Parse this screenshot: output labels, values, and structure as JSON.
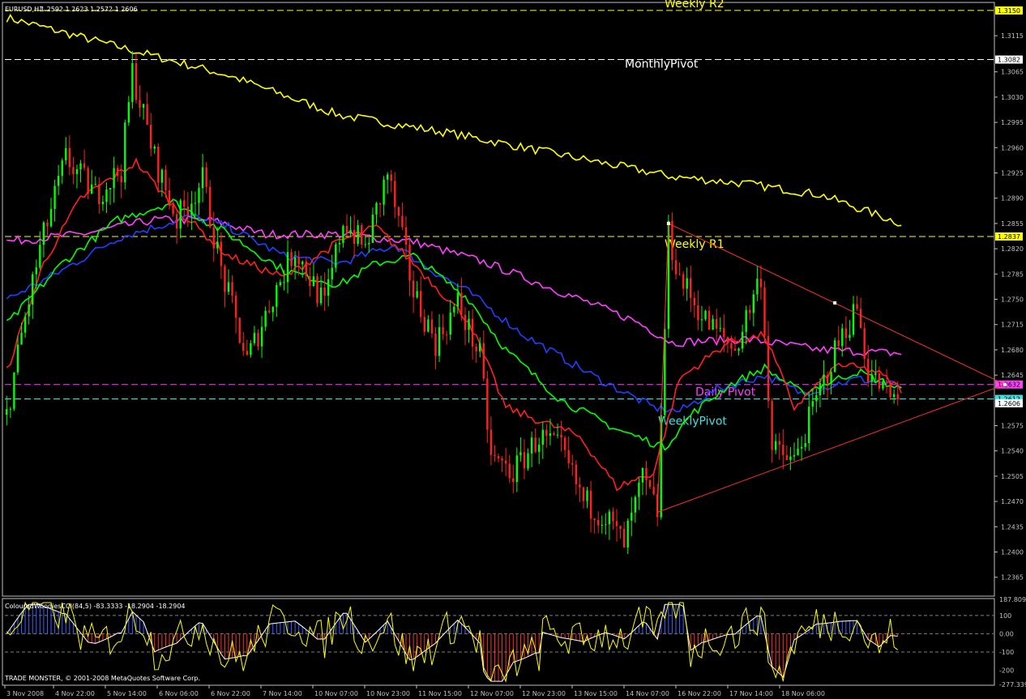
{
  "chart_header": {
    "symbol": "EURUSD,H1",
    "ohlc": "1.2592 1.2623 1.2572 1.2606"
  },
  "indicator_header": "ColouredWoodiesCCI(84,5) -83.3333 -18.2904 -18.2904",
  "copyright": "TRADE MONSTER, © 2001-2008 MetaQuotes Software Corp.",
  "colors": {
    "background": "#000000",
    "axis": "#c0c0c0",
    "bull": "#00ff00",
    "bear": "#ff2020",
    "yellow": "#ffff00",
    "magenta": "#ff40ff",
    "cyan": "#40e0e0",
    "blue": "#2040ff",
    "white": "#ffffff"
  },
  "chart_data": [
    {
      "type": "line",
      "title": "EURUSD,H1",
      "y_ticks": [
        "1.3115",
        "1.3065",
        "1.3030",
        "1.2995",
        "1.2960",
        "1.2925",
        "1.2890",
        "1.2855",
        "1.2820",
        "1.2785",
        "1.2750",
        "1.2715",
        "1.2680",
        "1.2645",
        "1.2575",
        "1.2540",
        "1.2505",
        "1.2470",
        "1.2435",
        "1.2400",
        "1.2365"
      ],
      "y_tick_values": [
        1.3115,
        1.3065,
        1.303,
        1.2995,
        1.296,
        1.2925,
        1.289,
        1.2855,
        1.282,
        1.2785,
        1.275,
        1.2715,
        1.268,
        1.2645,
        1.2575,
        1.254,
        1.2505,
        1.247,
        1.2435,
        1.24,
        1.2365
      ],
      "ylim": [
        1.234,
        1.316
      ],
      "x_labels": [
        "3 Nov 2008",
        "4 Nov 22:00",
        "5 Nov 14:00",
        "6 Nov 06:00",
        "6 Nov 22:00",
        "7 Nov 14:00",
        "10 Nov 07:00",
        "10 Nov 23:00",
        "11 Nov 15:00",
        "12 Nov 07:00",
        "12 Nov 23:00",
        "13 Nov 15:00",
        "14 Nov 07:00",
        "16 Nov 22:00",
        "17 Nov 14:00",
        "18 Nov 06:00"
      ],
      "bar_count": 242,
      "close_anchors": [
        [
          0,
          1.259
        ],
        [
          4,
          1.27
        ],
        [
          9,
          1.282
        ],
        [
          16,
          1.2945
        ],
        [
          24,
          1.2895
        ],
        [
          31,
          1.293
        ],
        [
          34,
          1.3065
        ],
        [
          40,
          1.2945
        ],
        [
          46,
          1.286
        ],
        [
          53,
          1.2915
        ],
        [
          58,
          1.279
        ],
        [
          65,
          1.2665
        ],
        [
          72,
          1.2755
        ],
        [
          78,
          1.282
        ],
        [
          86,
          1.274
        ],
        [
          91,
          1.286
        ],
        [
          97,
          1.282
        ],
        [
          103,
          1.2925
        ],
        [
          110,
          1.276
        ],
        [
          116,
          1.269
        ],
        [
          122,
          1.2745
        ],
        [
          128,
          1.267
        ],
        [
          131,
          1.253
        ],
        [
          137,
          1.251
        ],
        [
          144,
          1.256
        ],
        [
          150,
          1.254
        ],
        [
          156,
          1.247
        ],
        [
          162,
          1.245
        ],
        [
          167,
          1.241
        ],
        [
          172,
          1.25
        ],
        [
          176,
          1.2455
        ],
        [
          179,
          1.284
        ],
        [
          182,
          1.278
        ],
        [
          189,
          1.272
        ],
        [
          197,
          1.268
        ],
        [
          204,
          1.2785
        ],
        [
          207,
          1.254
        ],
        [
          213,
          1.2525
        ],
        [
          219,
          1.261
        ],
        [
          225,
          1.269
        ],
        [
          230,
          1.274
        ],
        [
          233,
          1.265
        ],
        [
          238,
          1.262
        ],
        [
          241,
          1.2606
        ]
      ],
      "horizontal_levels": [
        {
          "name": "Weekly R2",
          "value": 1.315,
          "label": "1.3150",
          "color": "#ffff00"
        },
        {
          "name": "MonthlyPivot",
          "value": 1.3082,
          "label": "1.3082",
          "color": "#ffffff"
        },
        {
          "name": "Weekly R1",
          "value": 1.2837,
          "label": "1.2837",
          "color": "#ffff00"
        },
        {
          "name": "Daily Pivot",
          "value": 1.2632,
          "label": "1.2632",
          "color": "#ff40ff"
        },
        {
          "name": "WeeklyPivot",
          "value": 1.2612,
          "label": "1.2612",
          "color": "#40e0e0"
        }
      ],
      "current_price": {
        "value": 1.2606,
        "label": "1.2606"
      },
      "moving_averages": [
        {
          "color": "#ffff00",
          "anchors": [
            [
              0,
              1.314
            ],
            [
              30,
              1.31
            ],
            [
              60,
              1.306
            ],
            [
              90,
              1.3005
            ],
            [
              120,
              1.298
            ],
            [
              150,
              1.295
            ],
            [
              180,
              1.292
            ],
            [
              200,
              1.291
            ],
            [
              220,
              1.2895
            ],
            [
              242,
              1.2855
            ]
          ]
        },
        {
          "color": "#ff40ff",
          "anchors": [
            [
              0,
              1.283
            ],
            [
              20,
              1.284
            ],
            [
              40,
              1.286
            ],
            [
              55,
              1.286
            ],
            [
              70,
              1.284
            ],
            [
              90,
              1.284
            ],
            [
              110,
              1.283
            ],
            [
              130,
              1.28
            ],
            [
              150,
              1.276
            ],
            [
              170,
              1.272
            ],
            [
              180,
              1.269
            ],
            [
              200,
              1.2695
            ],
            [
              220,
              1.268
            ],
            [
              242,
              1.2675
            ]
          ]
        },
        {
          "color": "#2040ff",
          "anchors": [
            [
              0,
              1.275
            ],
            [
              15,
              1.279
            ],
            [
              30,
              1.2835
            ],
            [
              50,
              1.2865
            ],
            [
              60,
              1.285
            ],
            [
              75,
              1.281
            ],
            [
              90,
              1.28
            ],
            [
              105,
              1.2825
            ],
            [
              115,
              1.279
            ],
            [
              125,
              1.276
            ],
            [
              140,
              1.27
            ],
            [
              160,
              1.264
            ],
            [
              175,
              1.26
            ],
            [
              182,
              1.2595
            ],
            [
              192,
              1.2625
            ],
            [
              205,
              1.2645
            ],
            [
              215,
              1.262
            ],
            [
              230,
              1.264
            ],
            [
              242,
              1.263
            ]
          ]
        },
        {
          "color": "#00ff00",
          "anchors": [
            [
              0,
              1.2715
            ],
            [
              15,
              1.28
            ],
            [
              30,
              1.286
            ],
            [
              45,
              1.2885
            ],
            [
              60,
              1.284
            ],
            [
              75,
              1.279
            ],
            [
              90,
              1.277
            ],
            [
              100,
              1.28
            ],
            [
              110,
              1.281
            ],
            [
              125,
              1.275
            ],
            [
              135,
              1.268
            ],
            [
              150,
              1.261
            ],
            [
              165,
              1.257
            ],
            [
              178,
              1.2545
            ],
            [
              185,
              1.259
            ],
            [
              195,
              1.263
            ],
            [
              205,
              1.2655
            ],
            [
              215,
              1.262
            ],
            [
              230,
              1.265
            ],
            [
              242,
              1.2625
            ]
          ]
        },
        {
          "color": "#ff2020",
          "anchors": [
            [
              0,
              1.265
            ],
            [
              10,
              1.28
            ],
            [
              20,
              1.289
            ],
            [
              35,
              1.294
            ],
            [
              45,
              1.288
            ],
            [
              60,
              1.281
            ],
            [
              75,
              1.278
            ],
            [
              90,
              1.283
            ],
            [
              100,
              1.285
            ],
            [
              110,
              1.28
            ],
            [
              125,
              1.272
            ],
            [
              135,
              1.26
            ],
            [
              145,
              1.258
            ],
            [
              155,
              1.256
            ],
            [
              165,
              1.249
            ],
            [
              175,
              1.251
            ],
            [
              182,
              1.264
            ],
            [
              195,
              1.269
            ],
            [
              205,
              1.27
            ],
            [
              213,
              1.26
            ],
            [
              225,
              1.266
            ],
            [
              235,
              1.265
            ],
            [
              242,
              1.2625
            ]
          ]
        }
      ],
      "triangle": {
        "top_x": 179,
        "top_y": 1.2855,
        "mid_x": 224,
        "mid_y": 1.2745,
        "bottom_x": 176,
        "bottom_y": 1.2455,
        "apex_x": 270,
        "apex_y": 1.2632
      }
    },
    {
      "type": "bar",
      "title": "ColouredWoodiesCCI(84,5)",
      "y_ticks": [
        "187.8099",
        "100",
        "0.00",
        "-100",
        "-200",
        "-277.3391"
      ],
      "y_tick_values": [
        187.8099,
        100,
        0,
        -100,
        -200,
        -277.3391
      ],
      "ylim": [
        -277.3391,
        187.8099
      ],
      "bar_count": 242
    }
  ]
}
